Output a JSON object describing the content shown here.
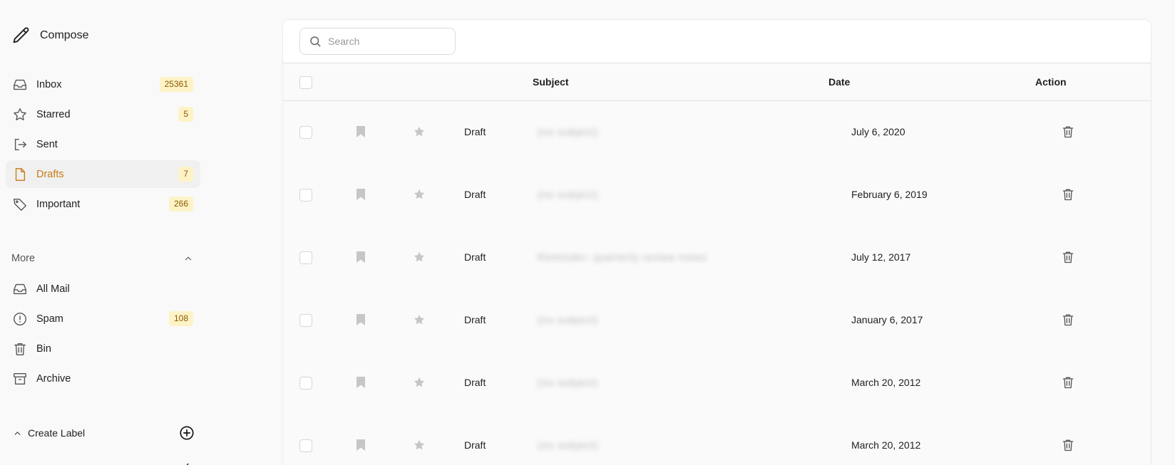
{
  "compose_label": "Compose",
  "nav": [
    {
      "label": "Inbox",
      "badge": "25361",
      "icon": "inbox-icon"
    },
    {
      "label": "Starred",
      "badge": "5",
      "icon": "star-icon"
    },
    {
      "label": "Sent",
      "badge": "",
      "icon": "sent-icon"
    },
    {
      "label": "Drafts",
      "badge": "7",
      "icon": "draft-file-icon",
      "active": true
    },
    {
      "label": "Important",
      "badge": "266",
      "icon": "tag-icon"
    }
  ],
  "more": {
    "title": "More",
    "items": [
      {
        "label": "All Mail",
        "badge": "",
        "icon": "inbox-icon"
      },
      {
        "label": "Spam",
        "badge": "108",
        "icon": "alert-circle-icon"
      },
      {
        "label": "Bin",
        "badge": "",
        "icon": "trash-icon"
      },
      {
        "label": "Archive",
        "badge": "",
        "icon": "archive-icon"
      }
    ]
  },
  "create_label": "Create Label",
  "search": {
    "placeholder": "Search",
    "value": ""
  },
  "table": {
    "headers": {
      "subject": "Subject",
      "date": "Date",
      "action": "Action"
    },
    "rows": [
      {
        "type": "Draft",
        "subject": "(no subject)",
        "date": "July 6, 2020"
      },
      {
        "type": "Draft",
        "subject": "(no subject)",
        "date": "February 6, 2019"
      },
      {
        "type": "Draft",
        "subject": "Reminder: quarterly review notes",
        "date": "July 12, 2017"
      },
      {
        "type": "Draft",
        "subject": "(no subject)",
        "date": "January 6, 2017"
      },
      {
        "type": "Draft",
        "subject": "(no subject)",
        "date": "March 20, 2012"
      },
      {
        "type": "Draft",
        "subject": "(no subject)",
        "date": "March 20, 2012"
      }
    ]
  },
  "colors": {
    "accent": "#c87a16",
    "badge_bg": "#fef3c7",
    "badge_text": "#8a5a00"
  }
}
